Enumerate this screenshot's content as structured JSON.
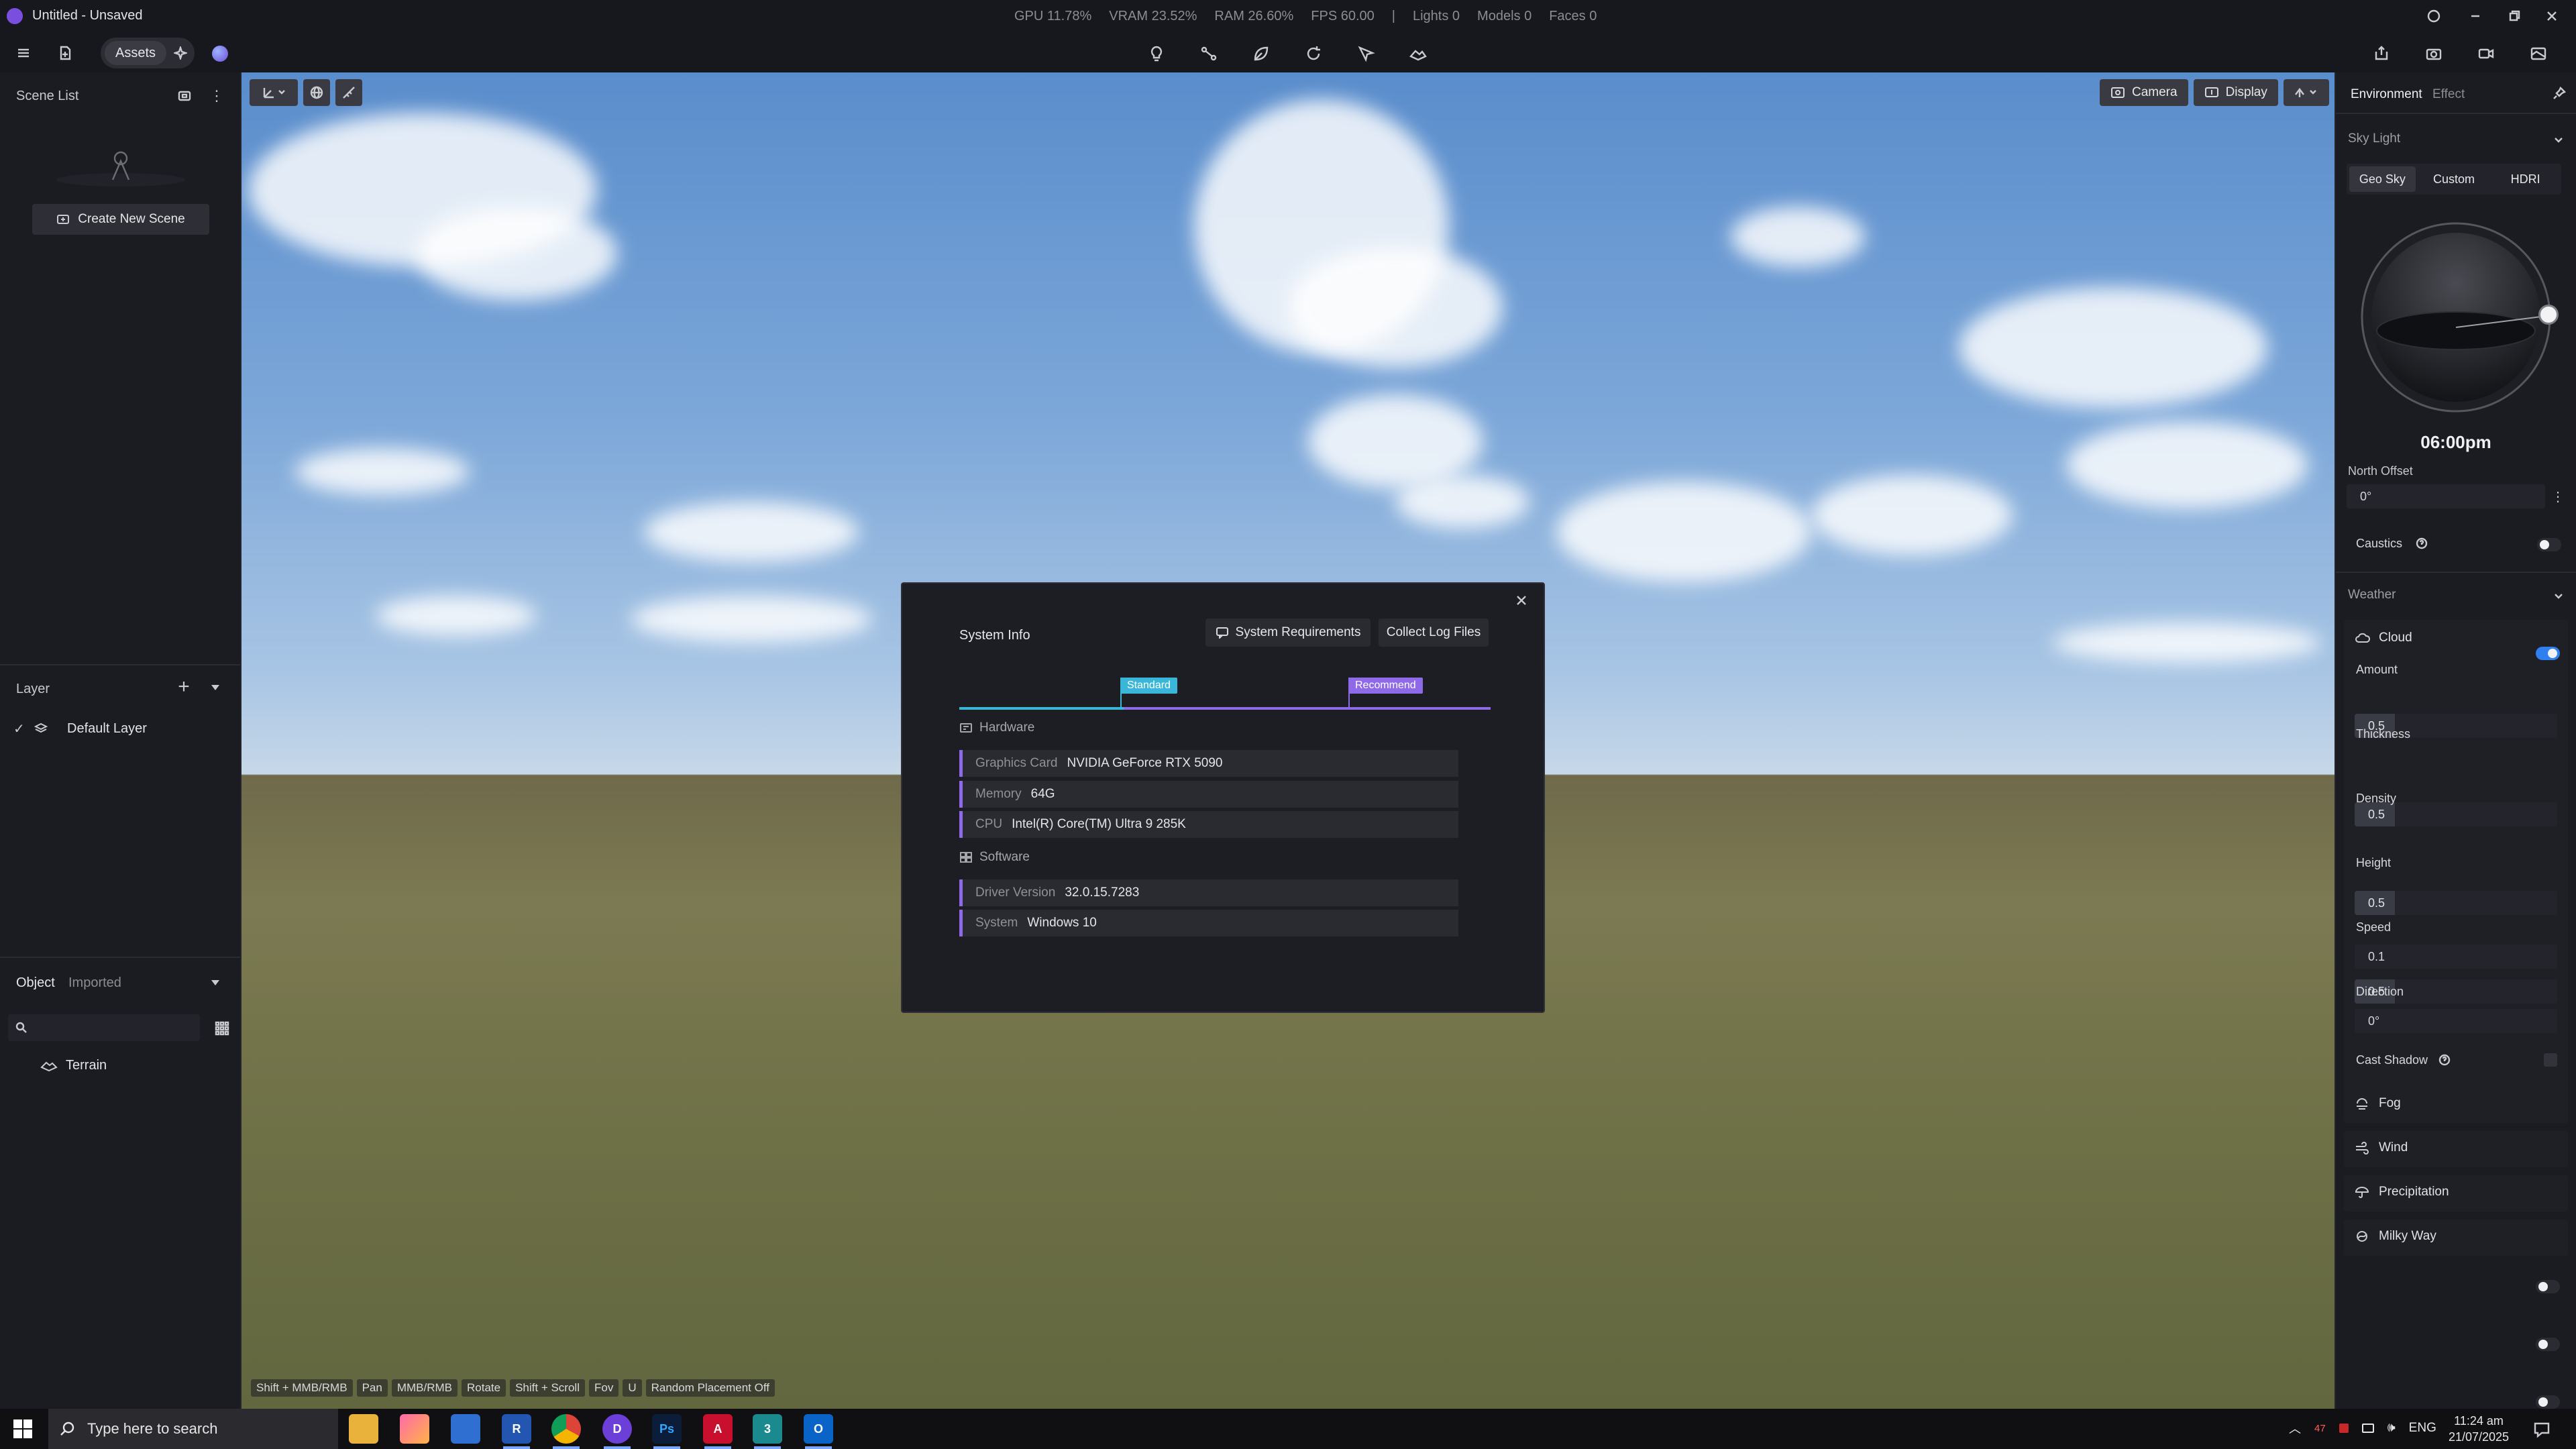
{
  "window": {
    "title": "Untitled - Unsaved",
    "stats": [
      "GPU 11.78%",
      "VRAM 23.52%",
      "RAM 26.60%",
      "FPS 60.00",
      "|",
      "Lights 0",
      "Models 0",
      "Faces 0"
    ]
  },
  "toolbar": {
    "assets_label": "Assets"
  },
  "scene_list": {
    "title": "Scene List",
    "create_button": "Create New Scene"
  },
  "layer": {
    "title": "Layer",
    "items": [
      "Default Layer"
    ]
  },
  "objects": {
    "tabs": [
      "Object",
      "Imported"
    ],
    "items": [
      "Terrain"
    ]
  },
  "viewport": {
    "camera_label": "Camera",
    "display_label": "Display",
    "hints": [
      "Shift + MMB/RMB",
      "Pan",
      "MMB/RMB",
      "Rotate",
      "Shift + Scroll",
      "Fov",
      "U",
      "Random Placement Off"
    ]
  },
  "dialog": {
    "title": "System Info",
    "sys_req_button": "System Requirements",
    "collect_logs_button": "Collect Log Files",
    "standard_label": "Standard",
    "recommend_label": "Recommend",
    "hardware_title": "Hardware",
    "software_title": "Software",
    "hardware": [
      {
        "key": "Graphics Card",
        "value": "NVIDIA GeForce RTX 5090"
      },
      {
        "key": "Memory",
        "value": "64G"
      },
      {
        "key": "CPU",
        "value": "Intel(R) Core(TM) Ultra 9 285K"
      }
    ],
    "software": [
      {
        "key": "Driver Version",
        "value": "32.0.15.7283"
      },
      {
        "key": "System",
        "value": "Windows 10"
      }
    ]
  },
  "environment": {
    "tabs": [
      "Environment",
      "Effect"
    ],
    "sky_light_title": "Sky Light",
    "sky_modes": [
      "Geo Sky",
      "Custom",
      "HDRI"
    ],
    "time": "06:00pm",
    "north_offset_label": "North Offset",
    "north_offset_value": "0°",
    "caustics_label": "Caustics",
    "weather_title": "Weather",
    "cloud_label": "Cloud",
    "cloud_on": true,
    "params": [
      {
        "label": "Amount",
        "value": "0.5",
        "level": 0.5
      },
      {
        "label": "Thickness",
        "value": "0.5",
        "level": 0.5
      },
      {
        "label": "Density",
        "value": "0.5",
        "level": 0.5
      },
      {
        "label": "Height",
        "value": "0.5",
        "level": 0.5
      }
    ],
    "speed_label": "Speed",
    "speed_value": "0.1",
    "direction_label": "Direction",
    "direction_value": "0°",
    "cast_shadow_label": "Cast Shadow",
    "effects": [
      "Fog",
      "Wind",
      "Precipitation",
      "Milky Way"
    ]
  },
  "taskbar": {
    "search_placeholder": "Type here to search",
    "lang": "ENG",
    "time": "11:24 am",
    "date": "21/07/2025",
    "tray_num": "47"
  },
  "colors": {
    "accent_purple": "#8e6ae8",
    "accent_cyan": "#3ab7d8",
    "toggle_blue": "#2f7ff0"
  }
}
